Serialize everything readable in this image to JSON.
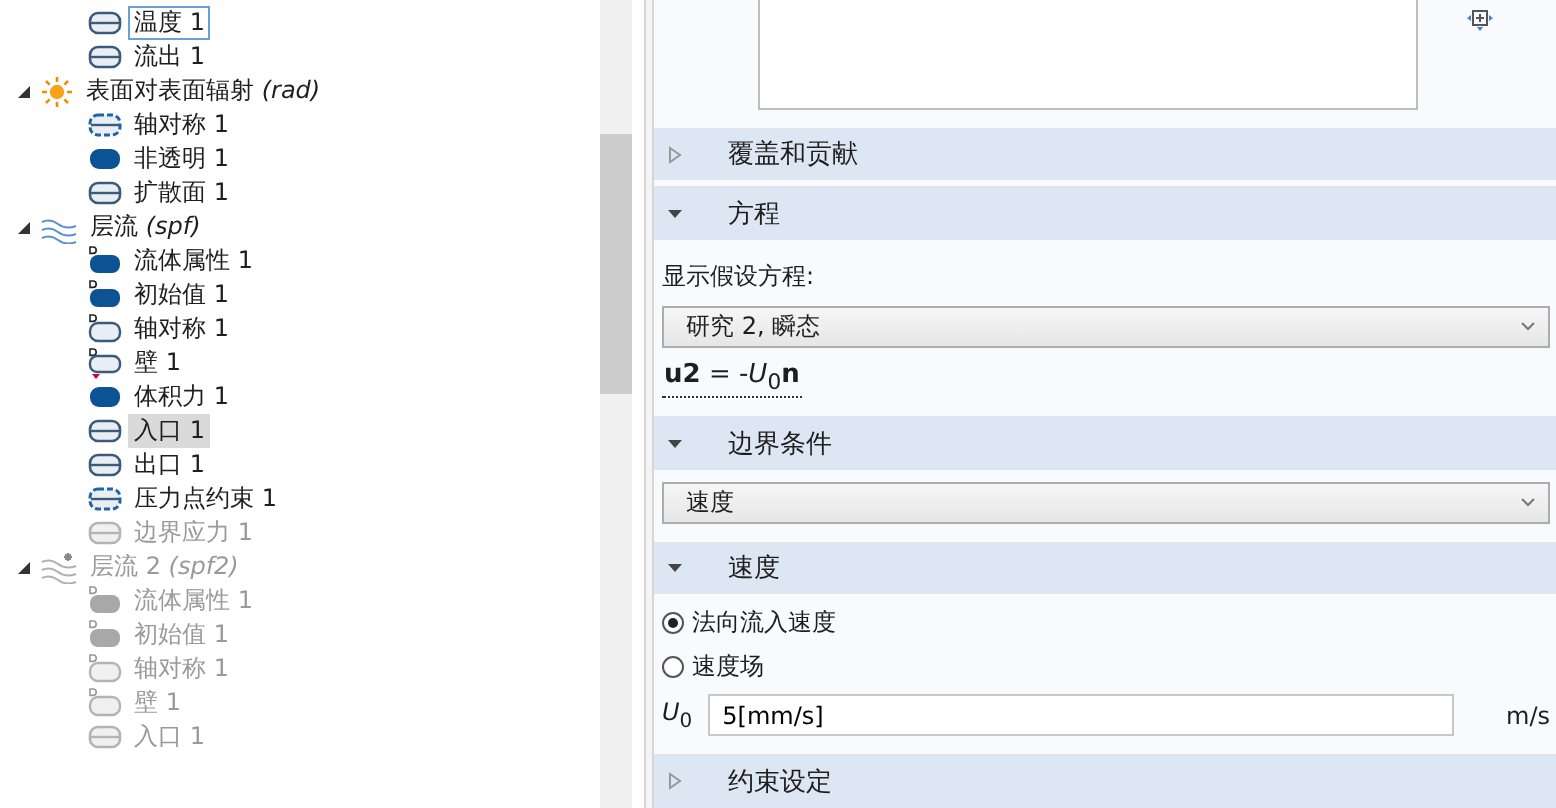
{
  "tree": [
    {
      "label": "温度 1",
      "kind": "boundary",
      "disabled": false,
      "selected": false,
      "focused": true
    },
    {
      "label": "流出 1",
      "kind": "boundary",
      "disabled": false,
      "selected": false,
      "focused": false
    },
    {
      "label": "表面对表面辐射 *(rad)*",
      "kind": "radiation",
      "disabled": false,
      "expanded": true,
      "children": [
        {
          "label": "轴对称 1",
          "kind": "dashed",
          "disabled": false,
          "selected": false,
          "focused": false
        },
        {
          "label": "非透明 1",
          "kind": "solid",
          "disabled": false,
          "selected": false,
          "focused": false
        },
        {
          "label": "扩散面 1",
          "kind": "boundary",
          "disabled": false,
          "selected": false,
          "focused": false
        }
      ]
    },
    {
      "label": "层流 *(spf)*",
      "kind": "flow",
      "disabled": false,
      "expanded": true,
      "children": [
        {
          "label": "流体属性 1",
          "kind": "default-solid",
          "disabled": false,
          "selected": false,
          "focused": false
        },
        {
          "label": "初始值 1",
          "kind": "default-solid",
          "disabled": false,
          "selected": false,
          "focused": false
        },
        {
          "label": "轴对称 1",
          "kind": "default-outline",
          "disabled": false,
          "selected": false,
          "focused": false
        },
        {
          "label": "壁 1",
          "kind": "default-wall",
          "disabled": false,
          "selected": false,
          "focused": false
        },
        {
          "label": "体积力 1",
          "kind": "solid",
          "disabled": false,
          "selected": false,
          "focused": false
        },
        {
          "label": "入口 1",
          "kind": "boundary",
          "disabled": false,
          "selected": true,
          "focused": false
        },
        {
          "label": "出口 1",
          "kind": "boundary",
          "disabled": false,
          "selected": false,
          "focused": false
        },
        {
          "label": "压力点约束 1",
          "kind": "dashed",
          "disabled": false,
          "selected": false,
          "focused": false
        },
        {
          "label": "边界应力 1",
          "kind": "boundary",
          "disabled": true,
          "selected": false,
          "focused": false
        }
      ]
    },
    {
      "label": "层流 2 *(spf2)*",
      "kind": "flow-star",
      "disabled": true,
      "expanded": true,
      "children": [
        {
          "label": "流体属性 1",
          "kind": "default-solid",
          "disabled": true,
          "selected": false,
          "focused": false
        },
        {
          "label": "初始值 1",
          "kind": "default-solid",
          "disabled": true,
          "selected": false,
          "focused": false
        },
        {
          "label": "轴对称 1",
          "kind": "default-outline",
          "disabled": true,
          "selected": false,
          "focused": false
        },
        {
          "label": "壁 1",
          "kind": "default-outline",
          "disabled": true,
          "selected": false,
          "focused": false
        },
        {
          "label": "入口 1",
          "kind": "boundary",
          "disabled": true,
          "selected": false,
          "focused": false
        }
      ]
    }
  ],
  "sections": [
    {
      "title": "覆盖和贡献",
      "expanded": false
    },
    {
      "title": "方程",
      "expanded": true,
      "content": [
        {
          "kind": "label",
          "text": "显示假设方程:"
        },
        {
          "kind": "select",
          "value": "研究 2, 瞬态"
        },
        {
          "kind": "equation",
          "text": "**u2** = -*U*$_{0}$**n**"
        }
      ]
    },
    {
      "title": "边界条件",
      "expanded": true,
      "content": [
        {
          "kind": "select",
          "value": "速度"
        }
      ]
    },
    {
      "title": "速度",
      "expanded": true,
      "content": [
        {
          "kind": "radio",
          "label": "法向流入速度",
          "selected": true
        },
        {
          "kind": "radio",
          "label": "速度场",
          "selected": false
        },
        {
          "kind": "field",
          "label": "*U*$_{0}$",
          "value": "5[mm/s]",
          "unit": "m/s"
        }
      ]
    },
    {
      "title": "约束设定",
      "expanded": false
    }
  ]
}
